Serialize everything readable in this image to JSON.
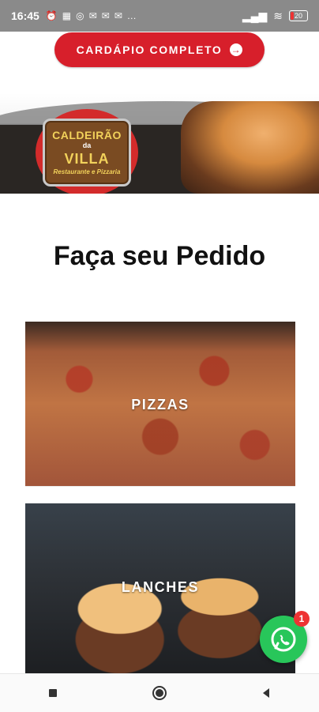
{
  "status": {
    "time": "16:45",
    "indicators": [
      "alarm-icon",
      "notes-icon",
      "whatsapp-icon",
      "messages-icon",
      "messages-icon",
      "messages-icon",
      "more-icon"
    ],
    "battery": "20"
  },
  "cta": {
    "label": "CARDÁPIO COMPLETO"
  },
  "hero": {
    "logo": {
      "line1": "CALDEIRÃO",
      "line2": "da",
      "line3": "VILLA",
      "line4": "Restaurante e Pizzaria"
    }
  },
  "order": {
    "title": "Faça seu Pedido"
  },
  "categories": [
    {
      "label": "PIZZAS"
    },
    {
      "label": "LANCHES"
    }
  ],
  "whatsapp": {
    "badge": "1"
  },
  "nav": [
    "recent-apps-icon",
    "home-icon",
    "back-icon"
  ]
}
